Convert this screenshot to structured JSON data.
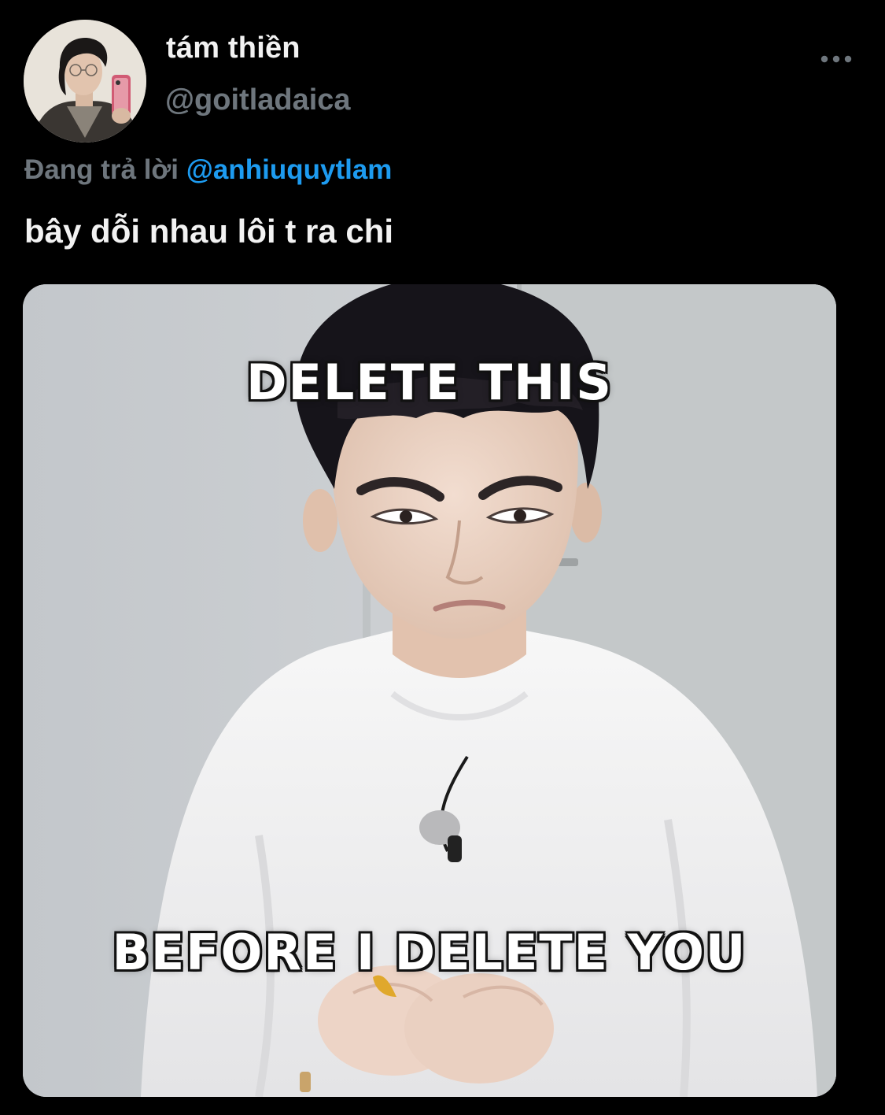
{
  "tweet": {
    "display_name": "tám thiền",
    "handle": "@goitladaica",
    "reply_prefix": "Đang trả lời",
    "reply_to": "@anhiuquytlam",
    "text": "bây dỗi nhau lôi t ra chi",
    "more_icon": "more-horizontal-icon",
    "avatar_icon": "profile-photo"
  },
  "media": {
    "caption_top": "DELETE THIS",
    "caption_bottom": "BEFORE I DELETE YOU"
  },
  "colors": {
    "background": "#000000",
    "primary_text": "#f2f2f2",
    "secondary_text": "#6e767d",
    "mention": "#1d9bf0"
  }
}
